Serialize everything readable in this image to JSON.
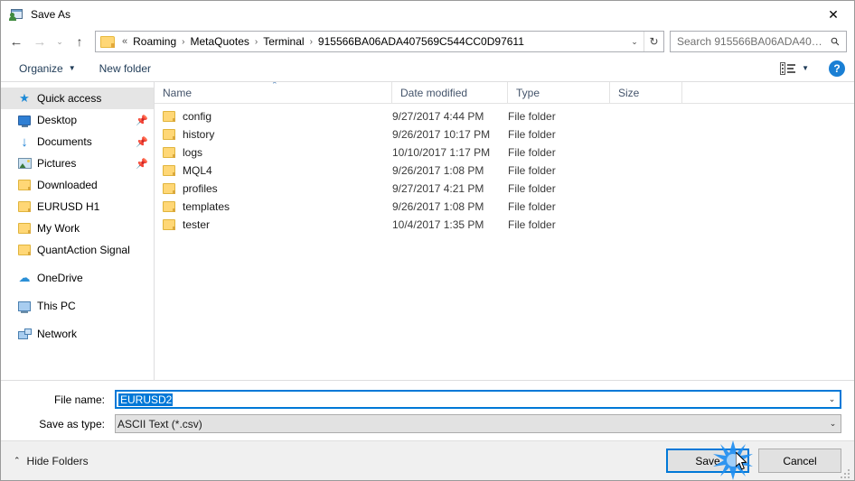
{
  "window": {
    "title": "Save As",
    "title_icon": "save-as-app-icon",
    "close_label": "✕"
  },
  "navigation": {
    "back_icon": "←",
    "forward_icon": "→",
    "recent_icon": "⌄",
    "up_icon": "↑",
    "refresh_icon": "↻",
    "dropdown_icon": "⌄",
    "breadcrumb_prefix": "«",
    "breadcrumb_separator": "›",
    "breadcrumbs": [
      "Roaming",
      "MetaQuotes",
      "Terminal",
      "915566BA06ADA407569C544CC0D97611"
    ]
  },
  "search": {
    "placeholder": "Search 915566BA06ADA40756...",
    "icon": "⚲"
  },
  "commandbar": {
    "organize_label": "Organize",
    "organize_caret": "▼",
    "new_folder_label": "New folder",
    "view_caret": "▼",
    "help_label": "?"
  },
  "sidebar": {
    "items": [
      {
        "label": "Quick access",
        "icon": "star-icon",
        "selected": true,
        "indent": 0,
        "pinned": false
      },
      {
        "label": "Desktop",
        "icon": "desktop-icon",
        "selected": false,
        "indent": 1,
        "pinned": true
      },
      {
        "label": "Documents",
        "icon": "documents-icon",
        "selected": false,
        "indent": 1,
        "pinned": true
      },
      {
        "label": "Pictures",
        "icon": "pictures-icon",
        "selected": false,
        "indent": 1,
        "pinned": true
      },
      {
        "label": "Downloaded",
        "icon": "folder-icon",
        "selected": false,
        "indent": 1,
        "pinned": false
      },
      {
        "label": "EURUSD H1",
        "icon": "folder-icon",
        "selected": false,
        "indent": 1,
        "pinned": false
      },
      {
        "label": "My Work",
        "icon": "folder-icon",
        "selected": false,
        "indent": 1,
        "pinned": false
      },
      {
        "label": "QuantAction Signal",
        "icon": "folder-icon",
        "selected": false,
        "indent": 1,
        "pinned": false
      },
      {
        "label": "OneDrive",
        "icon": "cloud-icon",
        "selected": false,
        "indent": 0,
        "pinned": false,
        "group": true
      },
      {
        "label": "This PC",
        "icon": "pc-icon",
        "selected": false,
        "indent": 0,
        "pinned": false,
        "group": true
      },
      {
        "label": "Network",
        "icon": "network-icon",
        "selected": false,
        "indent": 0,
        "pinned": false,
        "group": true
      }
    ],
    "pin_icon": "📌"
  },
  "filelist": {
    "columns": [
      "Name",
      "Date modified",
      "Type",
      "Size"
    ],
    "sort_column": "Name",
    "sort_caret": "⌃",
    "rows": [
      {
        "name": "config",
        "date": "9/27/2017 4:44 PM",
        "type": "File folder",
        "size": ""
      },
      {
        "name": "history",
        "date": "9/26/2017 10:17 PM",
        "type": "File folder",
        "size": ""
      },
      {
        "name": "logs",
        "date": "10/10/2017 1:17 PM",
        "type": "File folder",
        "size": ""
      },
      {
        "name": "MQL4",
        "date": "9/26/2017 1:08 PM",
        "type": "File folder",
        "size": ""
      },
      {
        "name": "profiles",
        "date": "9/27/2017 4:21 PM",
        "type": "File folder",
        "size": ""
      },
      {
        "name": "templates",
        "date": "9/26/2017 1:08 PM",
        "type": "File folder",
        "size": ""
      },
      {
        "name": "tester",
        "date": "10/4/2017 1:35 PM",
        "type": "File folder",
        "size": ""
      }
    ]
  },
  "form": {
    "filename_label": "File name:",
    "filename_value": "EURUSD2",
    "filename_selected": true,
    "filetype_label": "Save as type:",
    "filetype_value": "ASCII Text (*.csv)",
    "dropdown_icon": "⌄"
  },
  "footer": {
    "hide_folders_label": "Hide Folders",
    "hide_folders_caret": "⌃",
    "save_label": "Save",
    "cancel_label": "Cancel"
  },
  "colors": {
    "accent": "#0078d7",
    "selection": "#0078d7",
    "help_blue": "#1a7fd4",
    "folder_yellow": "#ffd776",
    "header_text": "#44546b",
    "footer_bg": "#f0f0f0"
  }
}
